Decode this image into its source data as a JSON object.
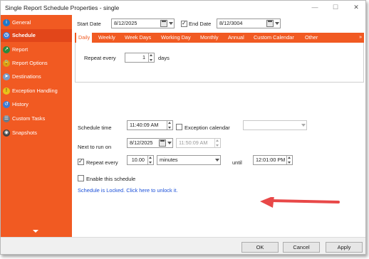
{
  "window": {
    "title": "Single Report Schedule Properties - single"
  },
  "sidebar": {
    "items": [
      {
        "label": "General",
        "icon": "info-icon",
        "active": false
      },
      {
        "label": "Schedule",
        "icon": "clock-icon",
        "active": true
      },
      {
        "label": "Report",
        "icon": "report-icon",
        "active": false
      },
      {
        "label": "Report Options",
        "icon": "lock-icon",
        "active": false
      },
      {
        "label": "Destinations",
        "icon": "paper-plane-icon",
        "active": false
      },
      {
        "label": "Exception Handling",
        "icon": "warning-icon",
        "active": false
      },
      {
        "label": "History",
        "icon": "history-icon",
        "active": false
      },
      {
        "label": "Custom Tasks",
        "icon": "tasks-icon",
        "active": false
      },
      {
        "label": "Snapshots",
        "icon": "snapshot-icon",
        "active": false
      }
    ]
  },
  "dates": {
    "start_label": "Start Date",
    "start_value": "8/12/2025",
    "end_label": "End Date",
    "end_value": "8/12/3004",
    "end_checked": true
  },
  "tabs": [
    "Daily",
    "Weekly",
    "Week Days",
    "Working Day",
    "Monthly",
    "Annual",
    "Custom Calendar",
    "Other"
  ],
  "active_tab": "Daily",
  "repeat_every": {
    "label": "Repeat every",
    "value": "1",
    "unit": "days"
  },
  "schedule": {
    "time_label": "Schedule time",
    "time_value": "11:40:09 AM",
    "exception_label": "Exception calendar",
    "exception_checked": false,
    "exception_value": "",
    "next_label": "Next to run on",
    "next_date": "8/12/2025",
    "next_time": "11:50:09 AM",
    "repeat_checked": true,
    "repeat_label": "Repeat every",
    "repeat_value": "10.00",
    "repeat_unit": "minutes",
    "until_label": "until",
    "until_value": "12:01:00 PM"
  },
  "enable": {
    "label": "Enable this schedule",
    "checked": false
  },
  "lock_link": "Schedule is Locked. Click here to unlock it.",
  "footer": {
    "ok": "OK",
    "cancel": "Cancel",
    "apply": "Apply"
  },
  "colors": {
    "accent": "#f15a22",
    "link": "#1a4fd8",
    "arrow": "#e84848"
  }
}
